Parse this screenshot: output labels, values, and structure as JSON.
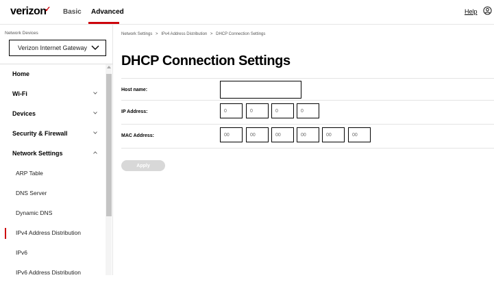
{
  "header": {
    "logo": "verizon",
    "logo_mark": "✓",
    "tabs": [
      "Basic",
      "Advanced"
    ],
    "help": "Help"
  },
  "sidebar": {
    "device_label": "Network Devices",
    "device_selected": "Verizon Internet Gateway",
    "items": [
      {
        "label": "Home"
      },
      {
        "label": "Wi-Fi"
      },
      {
        "label": "Devices"
      },
      {
        "label": "Security & Firewall"
      },
      {
        "label": "Network Settings"
      },
      {
        "label": "ARP Table"
      },
      {
        "label": "DNS Server"
      },
      {
        "label": "Dynamic DNS"
      },
      {
        "label": "IPv4 Address Distribution"
      },
      {
        "label": "IPv6"
      },
      {
        "label": "IPv6 Address Distribution"
      }
    ]
  },
  "breadcrumb": {
    "items": [
      "Network Settings",
      "IPv4 Address Distribution",
      "DHCP Connection Settings"
    ],
    "separator": ">"
  },
  "main": {
    "title": "DHCP Connection Settings",
    "host_name": {
      "label": "Host name:",
      "value": ""
    },
    "ip_address": {
      "label": "IP Address:",
      "values": [
        "0",
        "0",
        "0",
        "0"
      ]
    },
    "mac_address": {
      "label": "MAC Address:",
      "values": [
        "00",
        "00",
        "00",
        "00",
        "00",
        "00"
      ]
    },
    "apply_label": "Apply"
  },
  "colors": {
    "accent": "#cd040b",
    "button_disabled": "#d8d8d8"
  }
}
